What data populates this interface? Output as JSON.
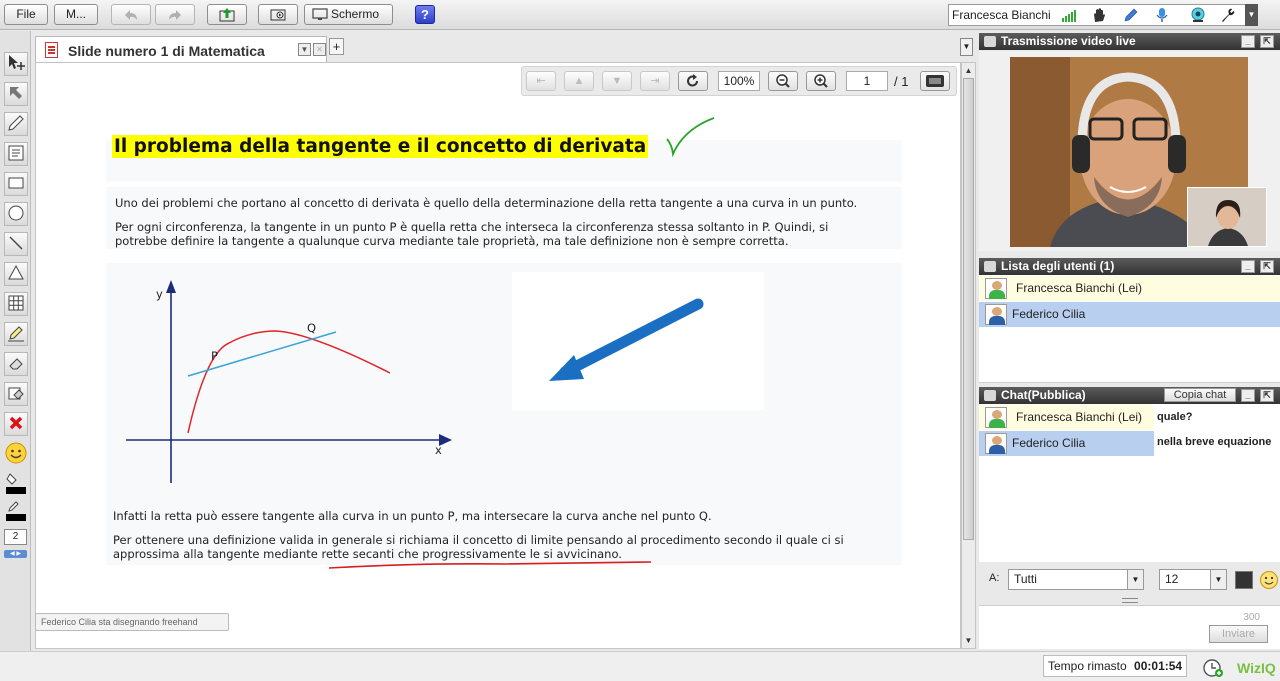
{
  "topbar": {
    "file": "File",
    "more": "M...",
    "screen": "Schermo",
    "help": "?",
    "user_name": "Francesca Bianchi"
  },
  "left_tools": {
    "size_value": "2"
  },
  "slide_tab": {
    "title": "Slide numero 1 di Matematica"
  },
  "slide_nav": {
    "zoom": "100%",
    "page": "1",
    "total": "/ 1"
  },
  "slide": {
    "heading": "Il problema della tangente e il concetto di derivata",
    "para1": "Uno dei problemi che portano al concetto di derivata è quello della determinazione della retta tangente a una curva in un punto.",
    "para2_line1": "Per ogni circonferenza, la tangente in un punto P è quella retta che interseca la circonferenza stessa soltanto in P. Quindi, si",
    "para2_line2": "potrebbe definire la tangente a qualunque curva mediante tale proprietà, ma tale definizione non è sempre corretta.",
    "graph_labels": {
      "y": "y",
      "x": "x",
      "p": "P",
      "q": "Q"
    },
    "para3": "Infatti la retta può essere tangente alla curva in un punto P, ma intersecare la curva anche nel punto Q.",
    "para4_line1": "Per ottenere una definizione valida in generale si richiama il concetto di limite pensando al procedimento secondo il quale ci si",
    "para4_line2": "approssima alla tangente mediante rette secanti che progressivamente le si avvicinano.",
    "status": "Federico Cilia sta disegnando freehand"
  },
  "panels": {
    "video_title": "Trasmissione video live",
    "users_title": "Lista degli utenti (1)",
    "users": [
      {
        "name": "Francesca Bianchi (Lei)"
      },
      {
        "name": "Federico Cilia"
      }
    ],
    "chat_title": "Chat(Pubblica)",
    "copy_chat": "Copia chat",
    "messages": [
      {
        "name": "Francesca Bianchi (Lei)",
        "text": "quale?"
      },
      {
        "name": "Federico Cilia",
        "text": "nella breve equazione"
      }
    ],
    "to_label": "A:",
    "recipient": "Tutti",
    "font_size": "12",
    "char_count": "300",
    "send": "Inviare"
  },
  "bottom": {
    "time_label": "Tempo rimasto",
    "time_value": "00:01:54",
    "brand": "WizIQ"
  },
  "colors": {
    "heading_highlight": "#ffff00",
    "arrow_blue": "#1a6fc2",
    "curve_red": "#e0262a",
    "tangent_blue": "#3aa3d8",
    "check_green": "#2aa52a",
    "me_row": "#fffde0",
    "other_row": "#b9cff0"
  }
}
